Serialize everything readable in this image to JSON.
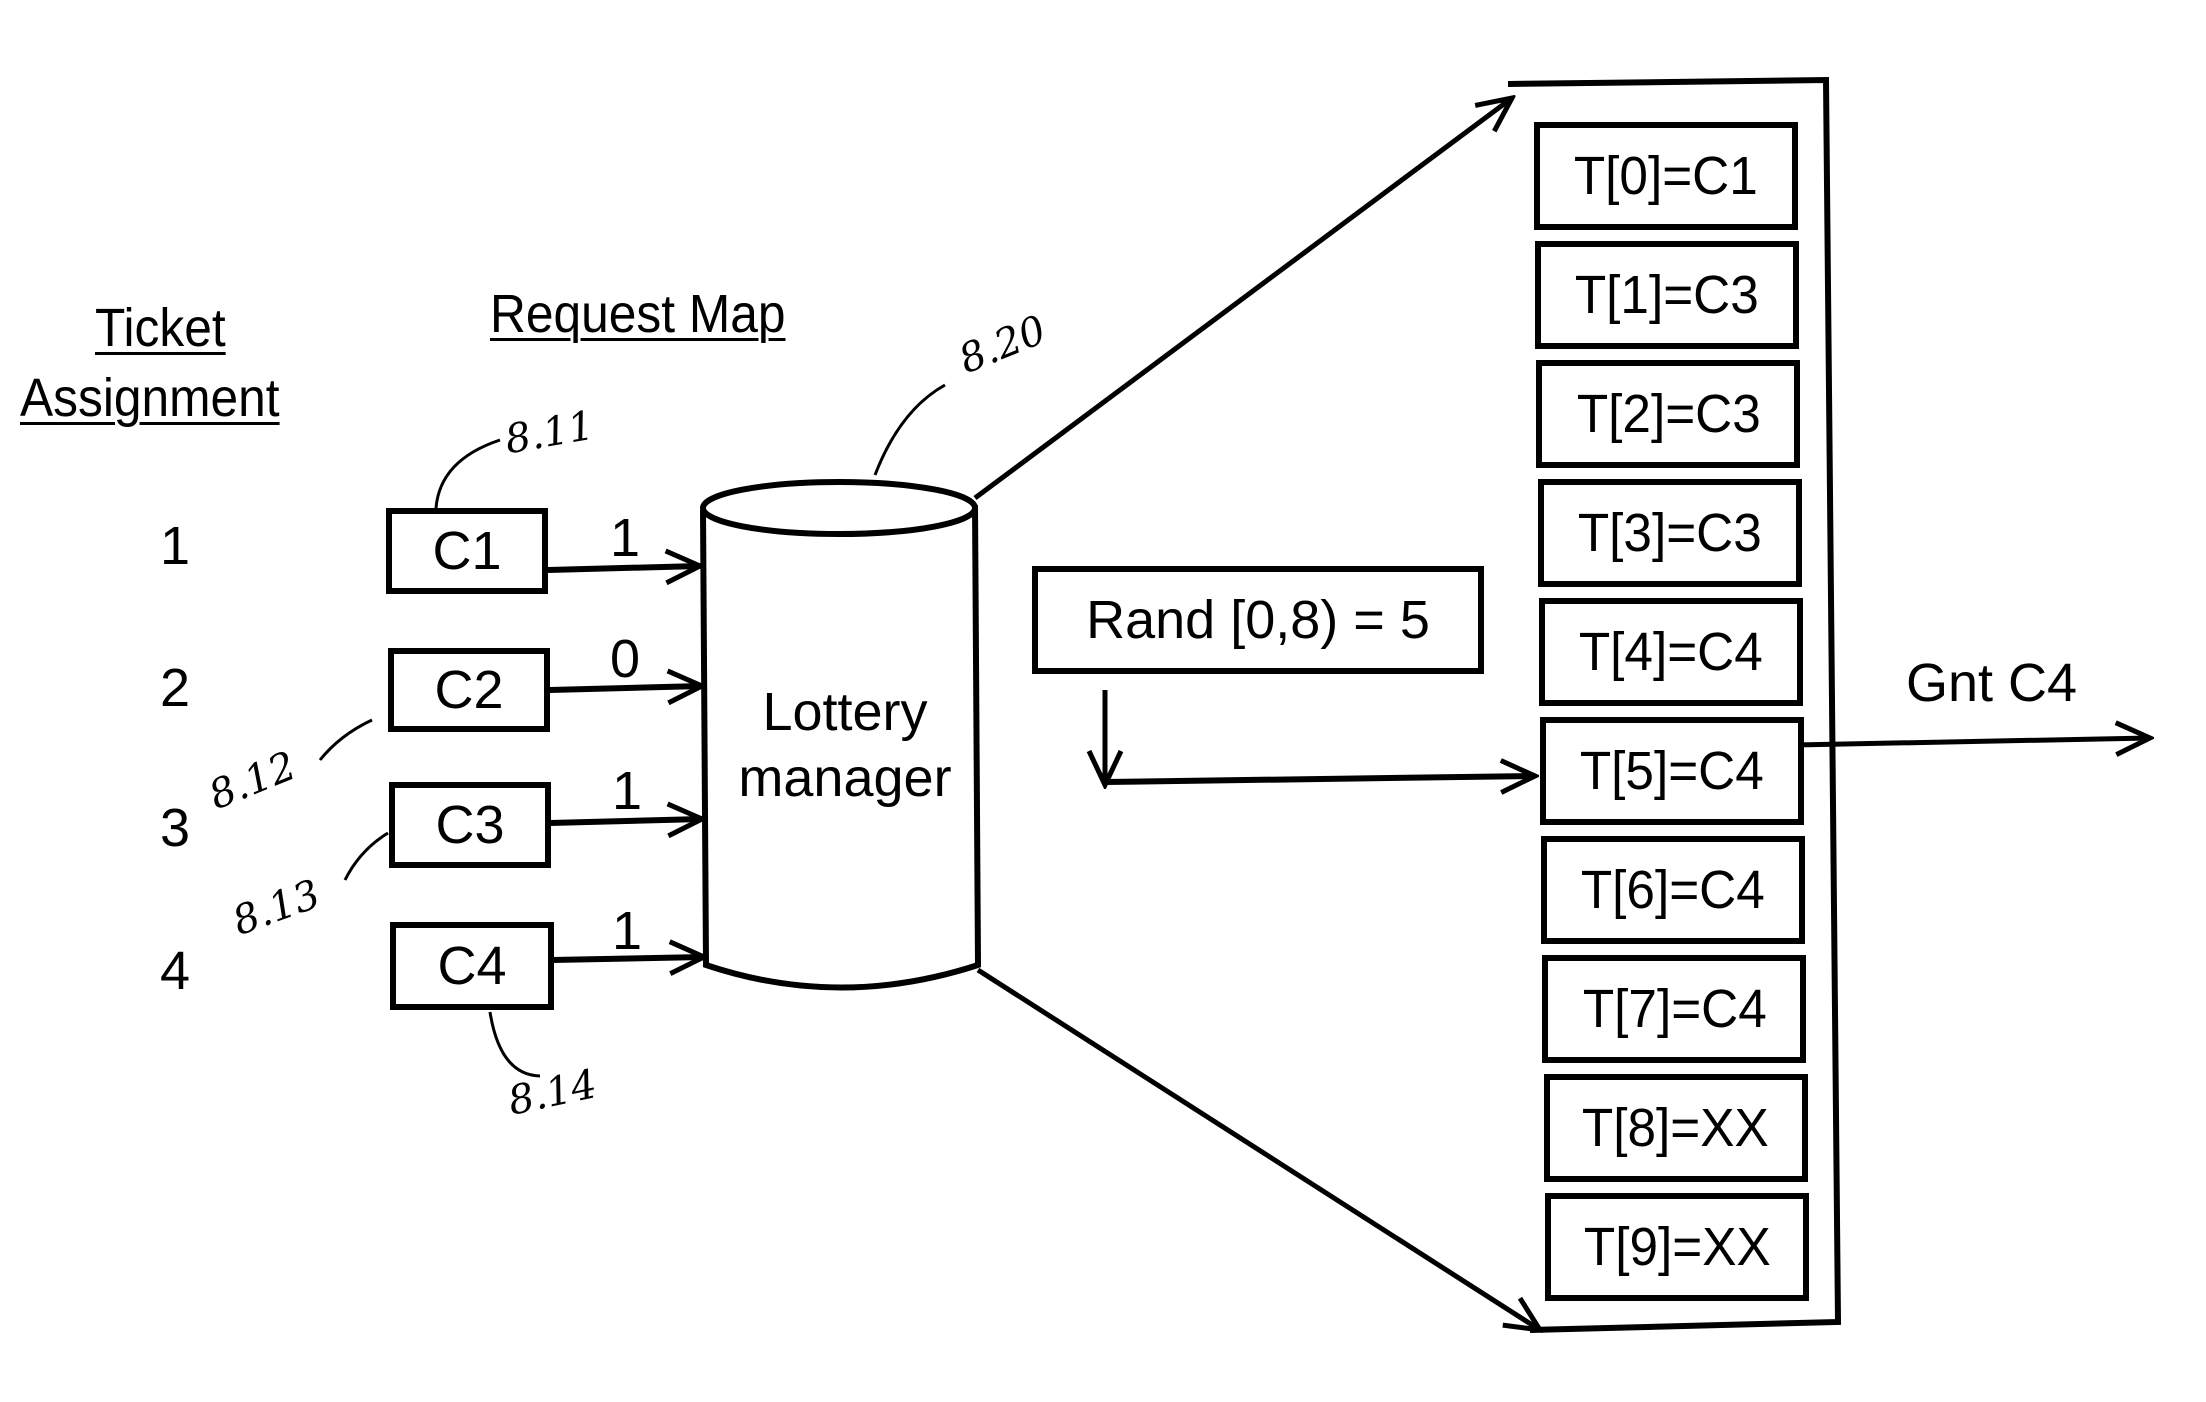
{
  "headers": {
    "ticket_assignment": [
      "Ticket",
      "Assignment"
    ],
    "request_map": "Request Map"
  },
  "ticket_numbers": [
    "1",
    "2",
    "3",
    "4"
  ],
  "clients": [
    {
      "label": "C1",
      "request": "1",
      "ref": "8.11"
    },
    {
      "label": "C2",
      "request": "0",
      "ref": "8.12"
    },
    {
      "label": "C3",
      "request": "1",
      "ref": "8.13"
    },
    {
      "label": "C4",
      "request": "1",
      "ref": "8.14"
    }
  ],
  "lottery_manager": {
    "label": [
      "Lottery",
      "manager"
    ],
    "ref": "8.20"
  },
  "rand": {
    "label": "Rand [0,8) = 5"
  },
  "ticket_table": [
    "T[0]=C1",
    "T[1]=C3",
    "T[2]=C3",
    "T[3]=C3",
    "T[4]=C4",
    "T[5]=C4",
    "T[6]=C4",
    "T[7]=C4",
    "T[8]=XX",
    "T[9]=XX"
  ],
  "selected_index": 5,
  "grant": {
    "label": "Gnt C4"
  }
}
